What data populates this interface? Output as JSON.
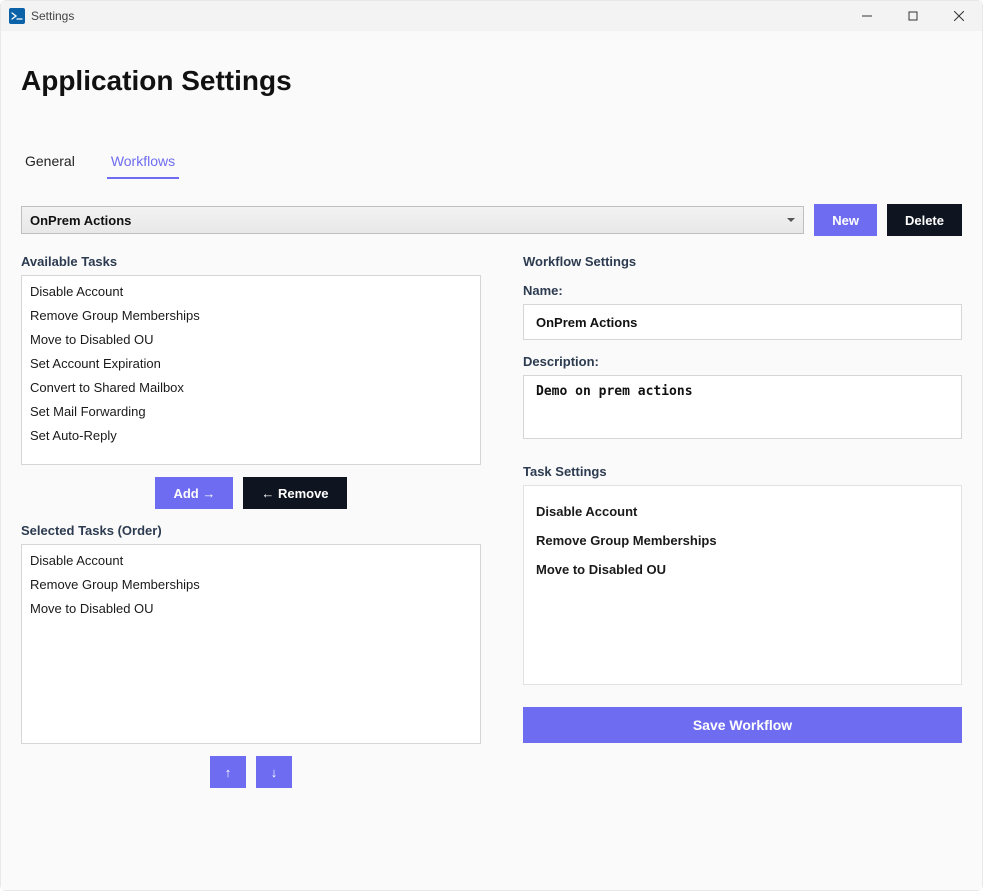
{
  "window": {
    "title": "Settings"
  },
  "page": {
    "heading": "Application Settings"
  },
  "tabs": {
    "general": "General",
    "workflows": "Workflows",
    "active": "workflows"
  },
  "toolbar": {
    "selected_workflow": "OnPrem Actions",
    "new_label": "New",
    "delete_label": "Delete"
  },
  "available_tasks": {
    "label": "Available Tasks",
    "items": [
      "Disable Account",
      "Remove Group Memberships",
      "Move to Disabled OU",
      "Set Account Expiration",
      "Convert to Shared Mailbox",
      "Set Mail Forwarding",
      "Set Auto-Reply"
    ]
  },
  "mid_buttons": {
    "add_label": "Add →",
    "remove_label": "← Remove"
  },
  "selected_tasks": {
    "label": "Selected Tasks (Order)",
    "items": [
      "Disable Account",
      "Remove Group Memberships",
      "Move to Disabled OU"
    ]
  },
  "reorder": {
    "up_label": "↑",
    "down_label": "↓"
  },
  "workflow_settings": {
    "heading": "Workflow Settings",
    "name_label": "Name:",
    "name_value": "OnPrem Actions",
    "description_label": "Description:",
    "description_value": "Demo on prem actions"
  },
  "task_settings": {
    "heading": "Task Settings",
    "items": [
      "Disable Account",
      "Remove Group Memberships",
      "Move to Disabled OU"
    ]
  },
  "save": {
    "label": "Save Workflow"
  },
  "colors": {
    "accent": "#6e6cf0",
    "dark": "#0f1520"
  }
}
